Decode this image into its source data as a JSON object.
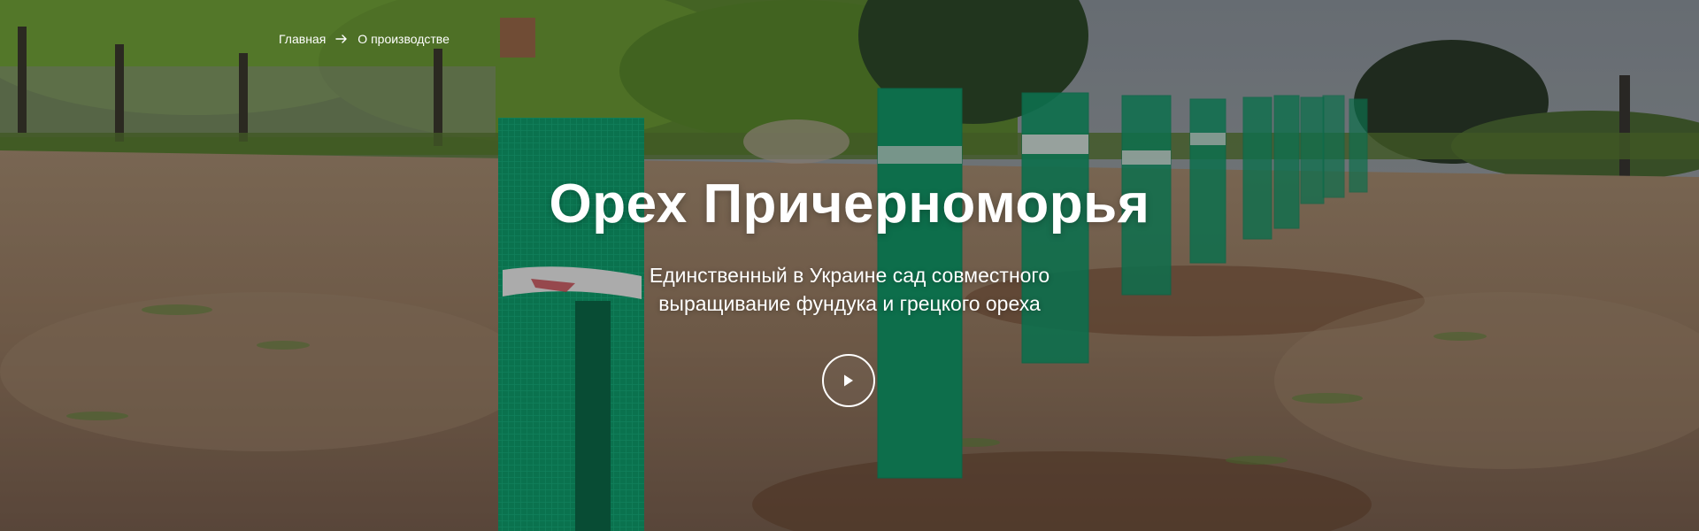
{
  "breadcrumb": {
    "items": [
      {
        "label": "Главная"
      },
      {
        "label": "О производстве"
      }
    ]
  },
  "hero": {
    "title": "Орех Причерноморья",
    "subtitle": "Единственный в Украине сад совместного выращивание фундука и грецкого ореха",
    "play_icon": "play-icon"
  },
  "colors": {
    "text": "#ffffff",
    "mesh_green": "#0f9b6e",
    "soil": "#8a6e55",
    "sky": "#8a9199"
  }
}
